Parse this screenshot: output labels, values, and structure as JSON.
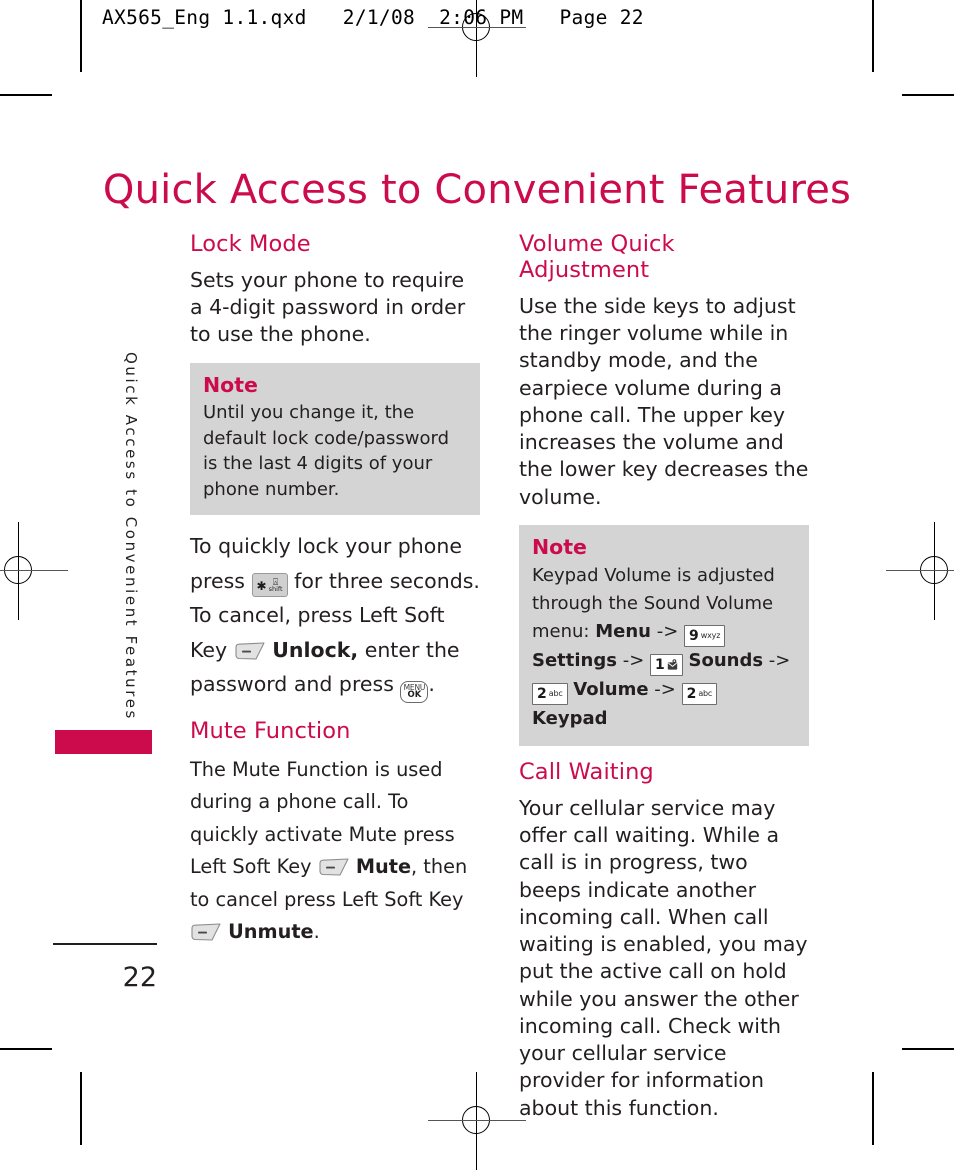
{
  "printer_slug": "AX565_Eng 1.1.qxd   2/1/08  2:06 PM   Page 22",
  "page_title": "Quick Access to Convenient Features",
  "side_tab_label": "Quick Access to Convenient Features",
  "folio": "22",
  "colors": {
    "accent": "#cc0b4d",
    "body_text": "#231f20",
    "note_background": "#d4d4d4",
    "keycap_fill": "#d0d0d0"
  },
  "left_column": {
    "lock_mode": {
      "heading": "Lock Mode",
      "intro": "Sets your phone to require a 4-digit password in order to use the phone.",
      "note": {
        "title": "Note",
        "body": "Until you change it, the default lock code/password is the last 4 digits of your phone number."
      },
      "instruction": {
        "part1": "To quickly lock your phone press",
        "part2": "for three seconds. To cancel, press Left Soft Key",
        "part3_bold": "Unlock,",
        "part4": "enter the password and press",
        "part5": "."
      }
    },
    "mute_function": {
      "heading": "Mute Function",
      "part1": "The Mute Function is used during a phone call. To quickly activate Mute press Left Soft Key",
      "part2_bold": "Mute",
      "part3": ", then to cancel press Left Soft Key",
      "part4_bold": "Unmute",
      "part5": "."
    }
  },
  "right_column": {
    "volume_quick_adjustment": {
      "heading": "Volume Quick Adjustment",
      "body": "Use the side keys to adjust the ringer volume while in standby mode, and the earpiece volume during a phone call. The upper key increases the volume and the lower key decreases the volume.",
      "note": {
        "title": "Note",
        "line1": "Keypad Volume is adjusted through the Sound Volume menu:",
        "seq_menu": "Menu",
        "arrow": "->",
        "seq_settings": "Settings",
        "seq_sounds": "Sounds",
        "seq_volume": "Volume",
        "seq_keypad": "Keypad"
      }
    },
    "call_waiting": {
      "heading": "Call Waiting",
      "body": "Your cellular service may offer call waiting. While a call is in progress, two beeps indicate another incoming call. When call waiting is enabled, you may put the active call on hold while you answer the other incoming call. Check with your cellular service provider for information about this function."
    }
  },
  "keys": {
    "star_shift": {
      "glyph": "✱",
      "sub": "shift"
    },
    "menu_ok": {
      "line1": "MENU",
      "line2": "OK"
    },
    "soft_key": {
      "label": "left-soft-key"
    },
    "nine_wxyz": {
      "num": "9",
      "sub": "wxyz"
    },
    "one_voicemail": {
      "num": "1",
      "sub": "voicemail"
    },
    "two_abc": {
      "num": "2",
      "sub": "abc"
    }
  }
}
